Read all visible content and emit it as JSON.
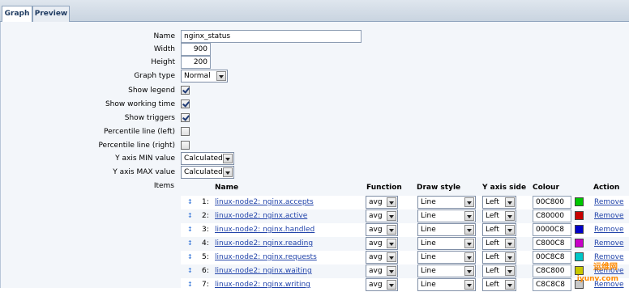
{
  "tabs": [
    {
      "label": "Graph",
      "active": true
    },
    {
      "label": "Preview",
      "active": false
    }
  ],
  "form": {
    "name": {
      "label": "Name",
      "value": "nginx_status"
    },
    "width": {
      "label": "Width",
      "value": "900"
    },
    "height": {
      "label": "Height",
      "value": "200"
    },
    "graph_type": {
      "label": "Graph type",
      "value": "Normal"
    },
    "show_legend": {
      "label": "Show legend",
      "checked": true
    },
    "show_working_time": {
      "label": "Show working time",
      "checked": true
    },
    "show_triggers": {
      "label": "Show triggers",
      "checked": true
    },
    "percentile_left": {
      "label": "Percentile line (left)",
      "checked": false
    },
    "percentile_right": {
      "label": "Percentile line (right)",
      "checked": false
    },
    "y_min": {
      "label": "Y axis MIN value",
      "value": "Calculated"
    },
    "y_max": {
      "label": "Y axis MAX value",
      "value": "Calculated"
    },
    "items_label": "Items"
  },
  "items_table": {
    "headers": {
      "name": "Name",
      "function": "Function",
      "draw_style": "Draw style",
      "y_axis_side": "Y axis side",
      "colour": "Colour",
      "action": "Action"
    },
    "rows": [
      {
        "num": "1:",
        "name": "linux-node2: nginx.accepts",
        "function": "avg",
        "draw_style": "Line",
        "y_axis_side": "Left",
        "colour": "00C800",
        "swatch": "#00c800",
        "action": "Remove"
      },
      {
        "num": "2:",
        "name": "linux-node2: nginx.active",
        "function": "avg",
        "draw_style": "Line",
        "y_axis_side": "Left",
        "colour": "C80000",
        "swatch": "#c80000",
        "action": "Remove"
      },
      {
        "num": "3:",
        "name": "linux-node2: nginx.handled",
        "function": "avg",
        "draw_style": "Line",
        "y_axis_side": "Left",
        "colour": "0000C8",
        "swatch": "#0000c8",
        "action": "Remove"
      },
      {
        "num": "4:",
        "name": "linux-node2: nginx.reading",
        "function": "avg",
        "draw_style": "Line",
        "y_axis_side": "Left",
        "colour": "C800C8",
        "swatch": "#c800c8",
        "action": "Remove"
      },
      {
        "num": "5:",
        "name": "linux-node2: nginx.requests",
        "function": "avg",
        "draw_style": "Line",
        "y_axis_side": "Left",
        "colour": "00C8C8",
        "swatch": "#00c8c8",
        "action": "Remove"
      },
      {
        "num": "6:",
        "name": "linux-node2: nginx.waiting",
        "function": "avg",
        "draw_style": "Line",
        "y_axis_side": "Left",
        "colour": "C8C800",
        "swatch": "#c8c800",
        "action": "Remove"
      },
      {
        "num": "7:",
        "name": "linux-node2: nginx.writing",
        "function": "avg",
        "draw_style": "Line",
        "y_axis_side": "Left",
        "colour": "C8C8C8",
        "swatch": "#c8c8c8",
        "action": "Remove"
      }
    ]
  },
  "watermark": {
    "text": "运维网",
    "sub": "iyunv.com"
  }
}
